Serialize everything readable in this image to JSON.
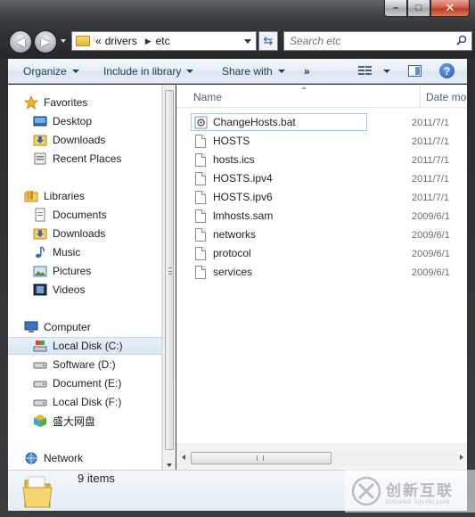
{
  "window": {
    "caption_buttons": {
      "minimize": "–",
      "maximize": "□",
      "close": "✕"
    }
  },
  "address_bar": {
    "overflow_marker": "«",
    "crumbs": [
      "drivers",
      "etc"
    ],
    "separator": "▶"
  },
  "search": {
    "placeholder": "Search etc"
  },
  "toolbar": {
    "organize": "Organize",
    "include_in_library": "Include in library",
    "share_with": "Share with",
    "more": "»",
    "help": "?"
  },
  "nav_pane": {
    "favorites": {
      "label": "Favorites",
      "items": [
        "Desktop",
        "Downloads",
        "Recent Places"
      ]
    },
    "libraries": {
      "label": "Libraries",
      "items": [
        "Documents",
        "Downloads",
        "Music",
        "Pictures",
        "Videos"
      ]
    },
    "computer": {
      "label": "Computer",
      "items": [
        "Local Disk (C:)",
        "Software (D:)",
        "Document (E:)",
        "Local Disk (F:)",
        "盛大网盘"
      ]
    },
    "network": {
      "label": "Network"
    }
  },
  "columns": {
    "name": "Name",
    "date": "Date modified"
  },
  "files": [
    {
      "name": "ChangeHosts.bat",
      "date": "2011/7/1"
    },
    {
      "name": "HOSTS",
      "date": "2011/7/1"
    },
    {
      "name": "hosts.ics",
      "date": "2011/7/1"
    },
    {
      "name": "HOSTS.ipv4",
      "date": "2011/7/1"
    },
    {
      "name": "HOSTS.ipv6",
      "date": "2011/7/1"
    },
    {
      "name": "lmhosts.sam",
      "date": "2009/6/1"
    },
    {
      "name": "networks",
      "date": "2009/6/1"
    },
    {
      "name": "protocol",
      "date": "2009/6/1"
    },
    {
      "name": "services",
      "date": "2009/6/1"
    }
  ],
  "details": {
    "items_count": "9 items"
  },
  "watermark": {
    "text": "创新互联",
    "pinyin": "CHUANG XIN HU LIAN"
  },
  "colors": {
    "accent": "#1e3959",
    "selection": "#d8e5f5"
  }
}
